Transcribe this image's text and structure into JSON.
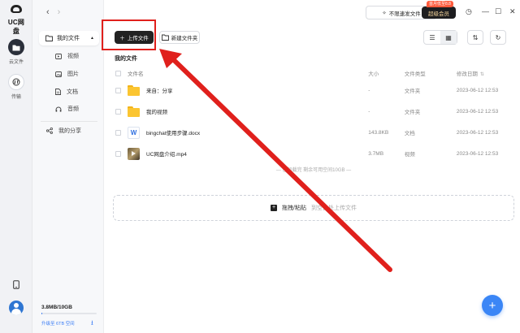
{
  "app": {
    "logo_text": "UC网盘"
  },
  "rail": {
    "items": [
      {
        "label": "云文件"
      },
      {
        "label": "传输"
      }
    ]
  },
  "sidebar": {
    "my_files": "我的文件",
    "items": [
      {
        "label": "视频"
      },
      {
        "label": "图片"
      },
      {
        "label": "文档"
      },
      {
        "label": "音频"
      }
    ],
    "share": "我的分享",
    "storage": "3.8MB/10GB",
    "storage_fraction": 0.02,
    "upgrade": "升级至 6TB 空间"
  },
  "header": {
    "speed_button": "不限速发文件",
    "vip_button": "超级会员",
    "vip_badge": "首月低至8.8"
  },
  "toolbar": {
    "upload": "上传文件",
    "new_folder": "新建文件夹"
  },
  "main": {
    "section_title": "我的文件",
    "columns": {
      "name": "文件名",
      "size": "大小",
      "type": "文件类型",
      "date": "修改日期"
    },
    "rows": [
      {
        "name": "来自：分享",
        "size": "-",
        "type": "文件夹",
        "date": "2023-06-12 12:53",
        "icon": "folder-icon"
      },
      {
        "name": "我的视频",
        "size": "-",
        "type": "文件夹",
        "date": "2023-06-12 12:53",
        "icon": "folder-icon"
      },
      {
        "name": "bingchat使用步骤.docx",
        "size": "143.8KB",
        "type": "文档",
        "date": "2023-06-12 12:53",
        "icon": "word-doc-icon"
      },
      {
        "name": "UC网盘介绍.mp4",
        "size": "3.7MB",
        "type": "视频",
        "date": "2023-06-12 12:53",
        "icon": "video-thumbnail-icon"
      }
    ],
    "end_text": "— 已加载完 剩余可用空间10GB —",
    "drop_main": "拖拽/粘贴",
    "drop_sub": "到空白处上传文件"
  },
  "annotation": {
    "color": "#e0201c"
  }
}
